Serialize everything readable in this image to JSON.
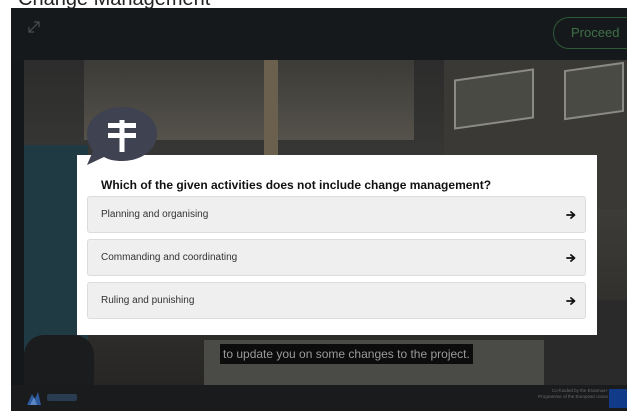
{
  "page": {
    "title": "Change Management"
  },
  "player": {
    "proceed_label": "Proceed",
    "subtitle": "to update you on some changes to the project.",
    "funded_text": "Co-funded by the Erasmus+ Programme of the European Union"
  },
  "quiz": {
    "question": "Which of the given activities does not include change management?",
    "options": [
      {
        "label": "Planning and organising"
      },
      {
        "label": "Commanding and coordinating"
      },
      {
        "label": "Ruling and punishing"
      }
    ]
  },
  "icons": {
    "badge": "signpost-speech-bubble-icon",
    "option_arrow": "arrow-right-icon",
    "expand": "expand-icon"
  },
  "colors": {
    "badge": "#3f4250",
    "proceed_border": "#2e5a37",
    "card_bg": "#ffffff",
    "option_bg": "#efefef"
  }
}
